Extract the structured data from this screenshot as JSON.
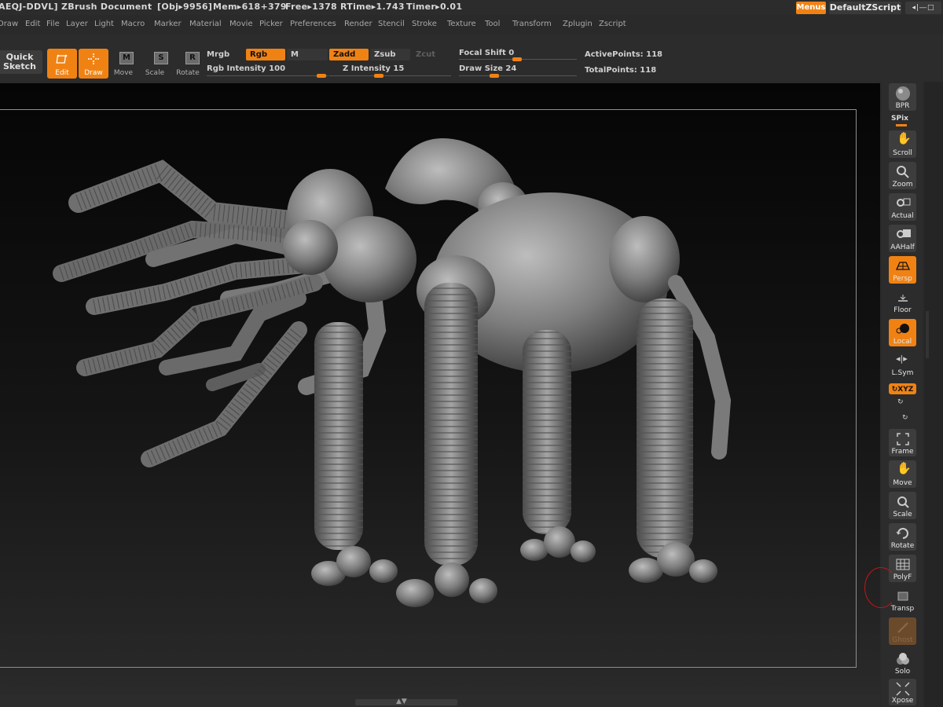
{
  "titlebar": {
    "doc_id": "AEQJ-DDVL]",
    "doc_name": "ZBrush  Document",
    "obj": "[Obj▸9956]",
    "mem": "Mem▸618+379",
    "free": "Free▸1378",
    "rtime": "RTime▸1.743",
    "timer": "Timer▸0.01",
    "menus_label": "Menus",
    "default_zscript": "DefaultZScript",
    "window_controls": "◂|―□"
  },
  "menubar": {
    "items": [
      "Draw",
      "Edit",
      "File",
      "Layer",
      "Light",
      "Macro",
      "Marker",
      "Material",
      "Movie",
      "Picker",
      "Preferences",
      "Render",
      "Stencil",
      "Stroke",
      "Texture",
      "Tool",
      "Transform",
      "Zplugin",
      "Zscript"
    ]
  },
  "toolbar": {
    "quick_sketch_line1": "Quick",
    "quick_sketch_line2": "Sketch",
    "edit_label": "Edit",
    "draw_label": "Draw",
    "move_label": "Move",
    "move_letter": "M",
    "scale_label": "Scale",
    "scale_letter": "S",
    "rotate_label": "Rotate",
    "rotate_letter": "R",
    "mrgb_label": "Mrgb",
    "rgb_label": "Rgb",
    "m_label": "M",
    "zadd_label": "Zadd",
    "zsub_label": "Zsub",
    "zcut_label": "Zcut",
    "rgb_intensity_label": "Rgb  Intensity 100",
    "rgb_intensity_value": 100,
    "z_intensity_label": "Z  Intensity 15",
    "z_intensity_value": 15,
    "focal_shift_label": "Focal  Shift 0",
    "focal_shift_value": 0,
    "draw_size_label": "Draw  Size 24",
    "draw_size_value": 24,
    "active_points": "ActivePoints: 118",
    "total_points": "TotalPoints: 118"
  },
  "right_shelf": {
    "bpr": "BPR",
    "spix": "SPix",
    "scroll": "Scroll",
    "zoom": "Zoom",
    "actual": "Actual",
    "aahalf": "AAHalf",
    "persp": "Persp",
    "floor": "Floor",
    "local": "Local",
    "lsym": "L.Sym",
    "xyz": "↻XYZ",
    "frame": "Frame",
    "move": "Move",
    "scale": "Scale",
    "rotate": "Rotate",
    "polyf": "PolyF",
    "transp": "Transp",
    "ghost": "Ghost",
    "solo": "Solo",
    "xpose": "Xpose"
  },
  "colors": {
    "accent": "#f08214",
    "panel": "#2c2c2c",
    "canvas_bg": "#000000",
    "model_gray": "#8a8a8a"
  }
}
